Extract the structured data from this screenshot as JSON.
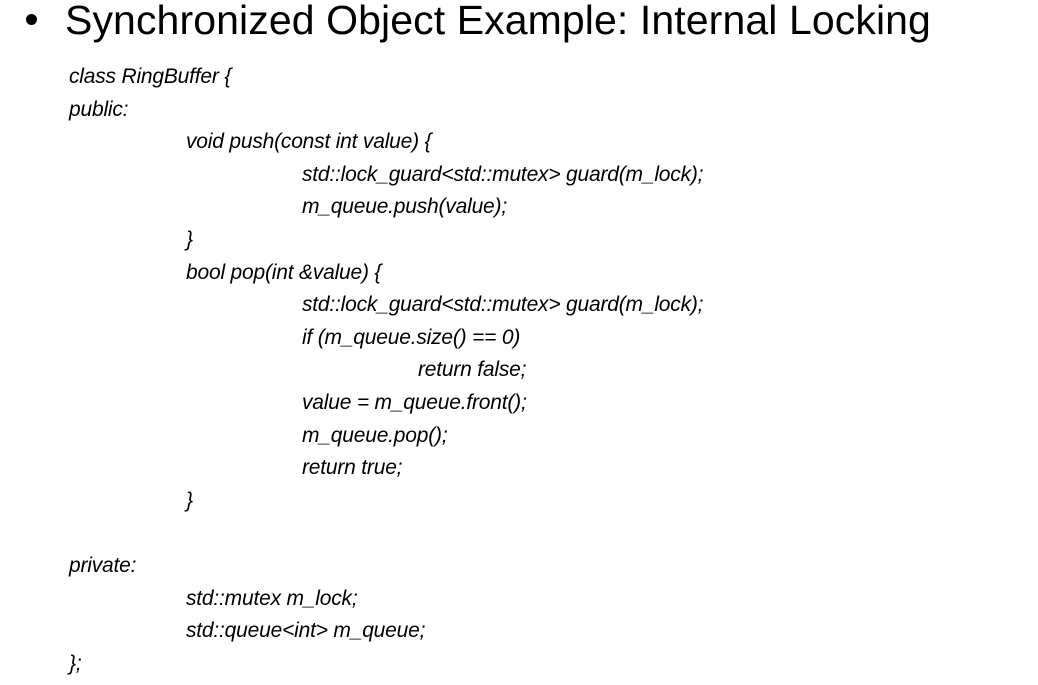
{
  "slide": {
    "title": "Synchronized Object Example: Internal Locking",
    "code_lines": [
      {
        "indent": 0,
        "text": "class RingBuffer {"
      },
      {
        "indent": 0,
        "text": "public:"
      },
      {
        "indent": 1,
        "text": "void push(const int value) {"
      },
      {
        "indent": 2,
        "text": "std::lock_guard<std::mutex> guard(m_lock);"
      },
      {
        "indent": 2,
        "text": "m_queue.push(value);"
      },
      {
        "indent": 1,
        "text": "}"
      },
      {
        "indent": 1,
        "text": "bool pop(int &value) {"
      },
      {
        "indent": 2,
        "text": "std::lock_guard<std::mutex> guard(m_lock);"
      },
      {
        "indent": 2,
        "text": "if (m_queue.size() == 0)"
      },
      {
        "indent": 3,
        "text": "return false;"
      },
      {
        "indent": 2,
        "text": "value = m_queue.front();"
      },
      {
        "indent": 2,
        "text": "m_queue.pop();"
      },
      {
        "indent": 2,
        "text": "return true;"
      },
      {
        "indent": 1,
        "text": "}"
      },
      {
        "indent": 0,
        "text": ""
      },
      {
        "indent": 0,
        "text": "private:"
      },
      {
        "indent": 1,
        "text": "std::mutex m_lock;"
      },
      {
        "indent": 1,
        "text": "std::queue<int> m_queue;"
      },
      {
        "indent": 0,
        "text": "};"
      }
    ]
  }
}
